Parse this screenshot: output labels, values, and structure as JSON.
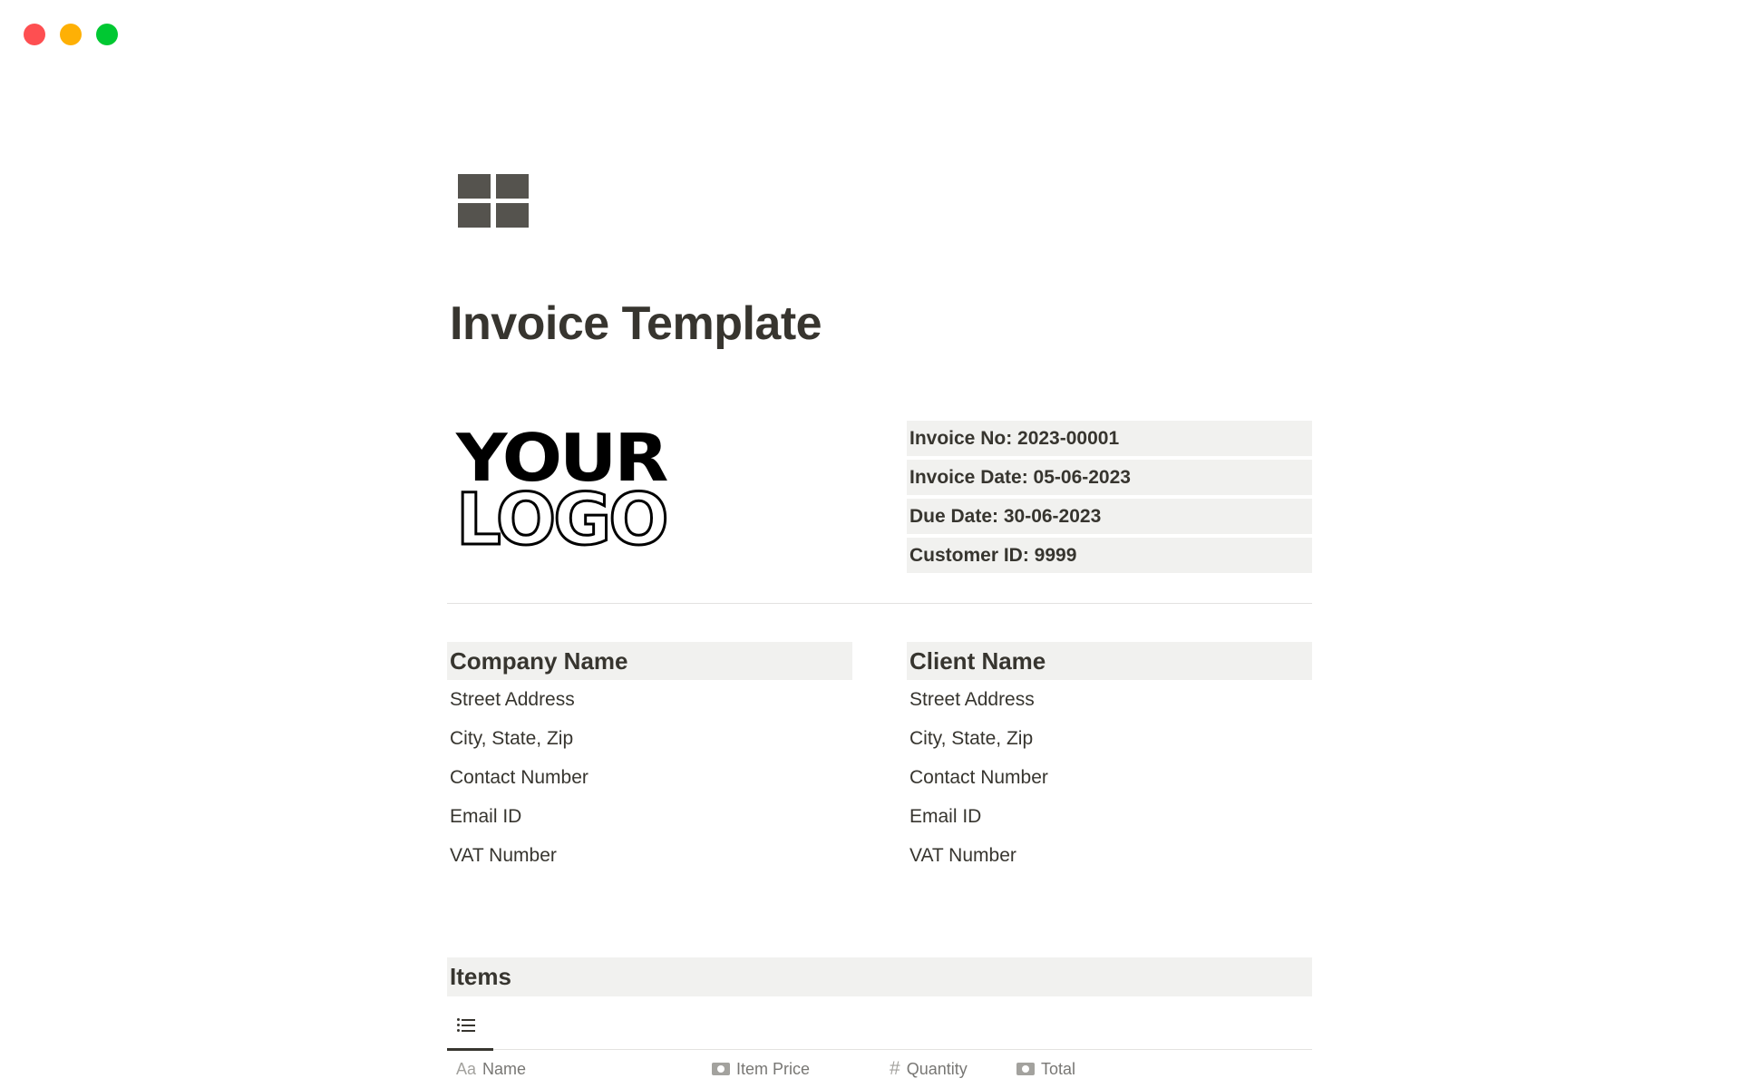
{
  "window": {
    "controls": [
      "close",
      "minimize",
      "zoom"
    ],
    "colors": {
      "close": "#fe4f51",
      "minimize": "#feb005",
      "zoom": "#00c832"
    }
  },
  "page": {
    "icon": "grid-icon",
    "title": "Invoice Template"
  },
  "logo": {
    "line1": "YOUR",
    "line2": "LOGO"
  },
  "invoice_info": [
    "Invoice No: 2023-00001",
    "Invoice Date: 05-06-2023",
    "Due Date: 30-06-2023",
    "Customer ID: 9999"
  ],
  "company": {
    "header": "Company Name",
    "lines": [
      "Street Address",
      "City, State, Zip",
      "Contact Number",
      "Email ID",
      "VAT Number"
    ]
  },
  "client": {
    "header": "Client Name",
    "lines": [
      "Street Address",
      "City, State, Zip",
      "Contact Number",
      "Email ID",
      "VAT Number"
    ]
  },
  "items": {
    "header": "Items",
    "view_tab_icon": "list-icon",
    "columns": [
      {
        "icon": "text-icon",
        "icon_text": "Aa",
        "label": "Name"
      },
      {
        "icon": "money-icon",
        "label": "Item Price"
      },
      {
        "icon": "number-icon",
        "icon_text": "#",
        "label": "Quantity"
      },
      {
        "icon": "money-icon",
        "label": "Total"
      }
    ]
  }
}
